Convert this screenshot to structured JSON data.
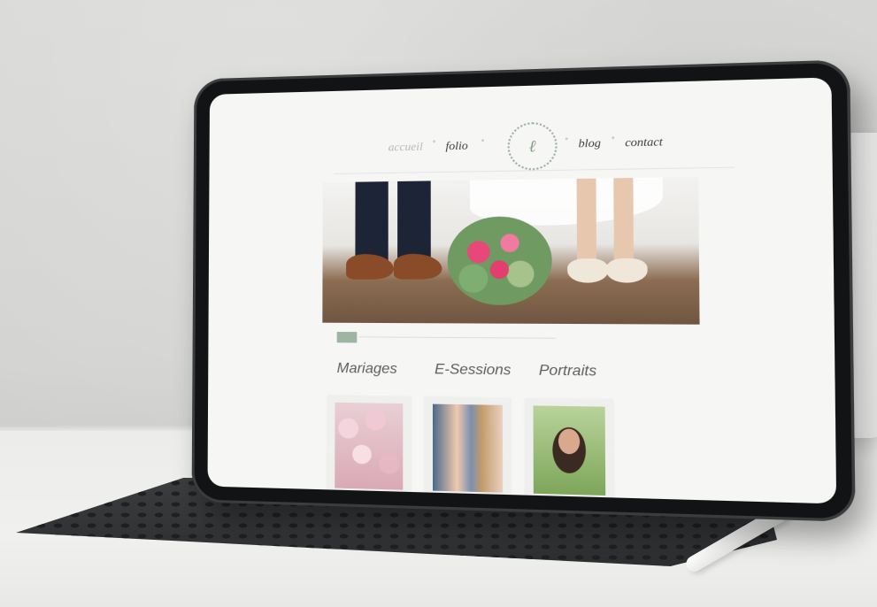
{
  "website": {
    "nav": {
      "items": [
        {
          "label": "accueil",
          "state": "dim"
        },
        {
          "label": "folio",
          "state": "active"
        },
        {
          "label": "blog",
          "state": "normal"
        },
        {
          "label": "contact",
          "state": "normal"
        }
      ]
    },
    "categories": [
      {
        "title": "Mariages"
      },
      {
        "title": "E-Sessions"
      },
      {
        "title": "Portraits"
      }
    ]
  },
  "colors": {
    "accent": "#9fb5a3",
    "screen_background": "#f6f6f4",
    "device_frame": "#111314"
  }
}
